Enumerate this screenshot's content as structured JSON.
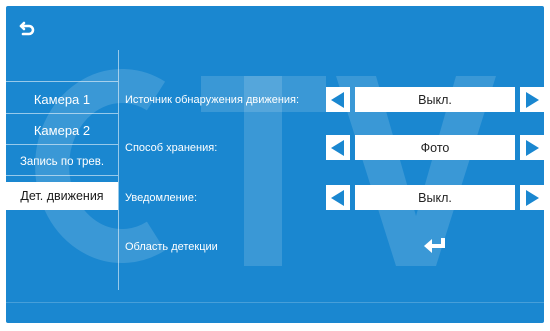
{
  "sidebar": {
    "items": [
      {
        "label": "Камера 1",
        "active": false
      },
      {
        "label": "Камера 2",
        "active": false
      },
      {
        "label": "Запись по трев.",
        "active": false
      },
      {
        "label": "Дет. движения",
        "active": true
      }
    ]
  },
  "settings": {
    "source": {
      "label": "Источник обнаружения движения:",
      "value": "Выкл."
    },
    "storage": {
      "label": "Способ хранения:",
      "value": "Фото"
    },
    "notification": {
      "label": "Уведомление:",
      "value": "Выкл."
    },
    "detection_area": {
      "label": "Область детекции"
    }
  },
  "icons": {
    "back": "back-arrow-icon",
    "left": "arrow-left-icon",
    "right": "arrow-right-icon",
    "enter": "enter-icon"
  },
  "colors": {
    "background": "#1a87d0",
    "arrow": "#1a87d0",
    "text": "#ffffff",
    "active_bg": "#ffffff"
  },
  "watermark": "CTV"
}
